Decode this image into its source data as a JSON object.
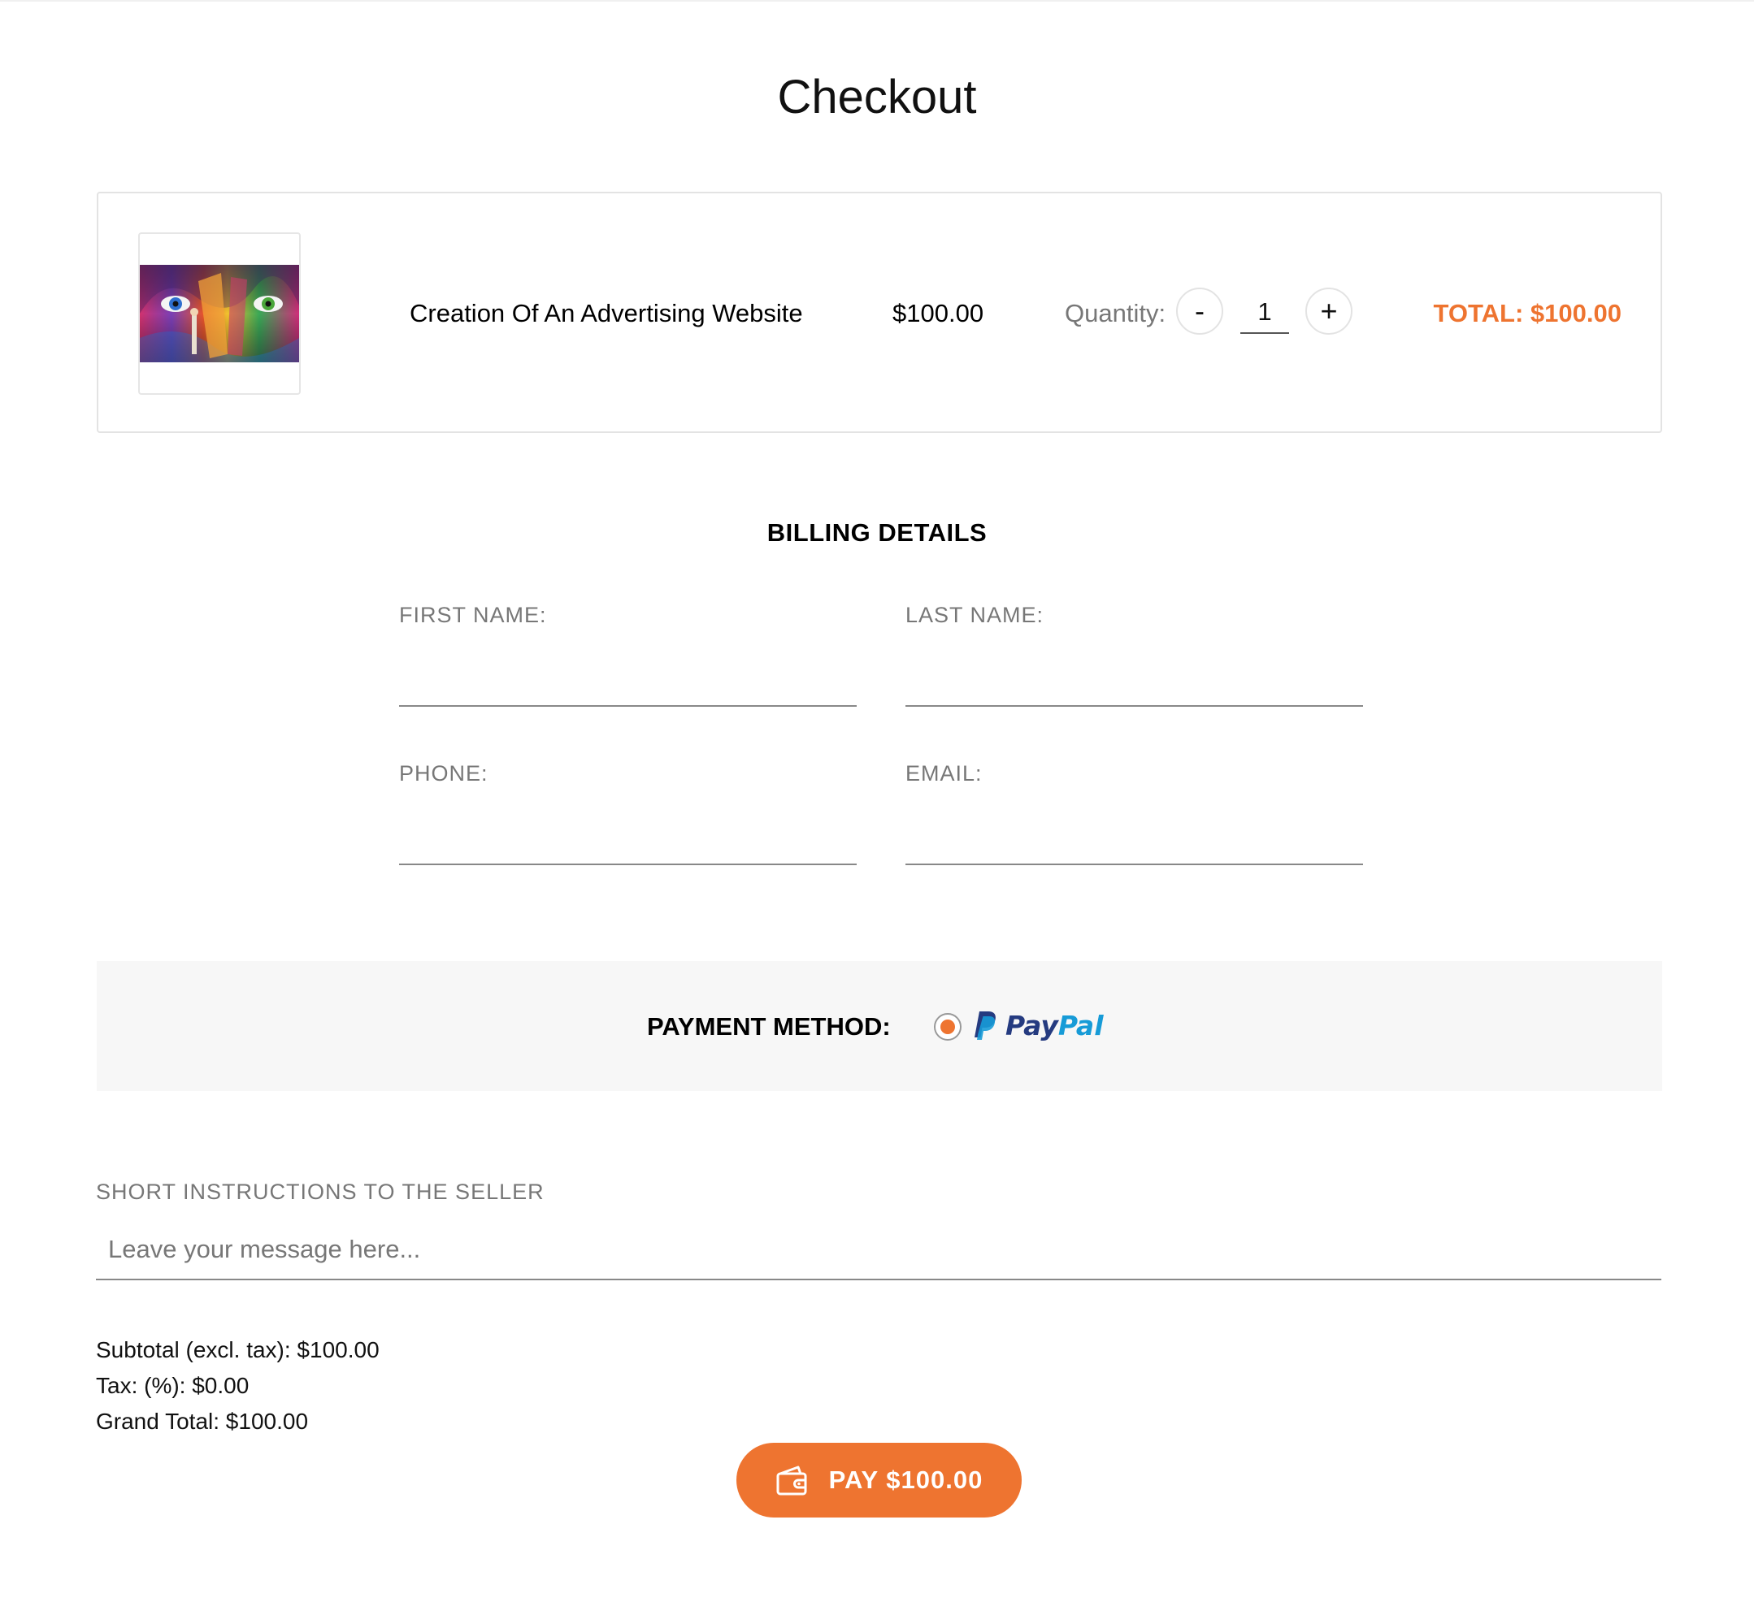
{
  "page": {
    "title": "Checkout"
  },
  "cart": {
    "product_name": "Creation Of An Advertising Website",
    "price": "$100.00",
    "quantity_label": "Quantity:",
    "decrement_label": "-",
    "increment_label": "+",
    "quantity_value": "1",
    "line_total": "TOTAL: $100.00",
    "thumbnail_icon": "colorful-face-painting-image"
  },
  "billing": {
    "heading": "BILLING DETAILS",
    "first_name_label": "FIRST NAME:",
    "first_name_value": "",
    "last_name_label": "LAST NAME:",
    "last_name_value": "",
    "phone_label": "PHONE:",
    "phone_value": "",
    "email_label": "EMAIL:",
    "email_value": ""
  },
  "payment": {
    "label": "PAYMENT METHOD:",
    "selected_method": "PayPal",
    "paypal_pay": "Pay",
    "paypal_pal": "Pal"
  },
  "instructions": {
    "label": "SHORT INSTRUCTIONS TO THE SELLER",
    "placeholder": "Leave your message here...",
    "value": ""
  },
  "summary": {
    "subtotal": "Subtotal (excl. tax): $100.00",
    "tax": "Tax: (%): $0.00",
    "grand_total": "Grand Total: $100.00"
  },
  "pay_button": {
    "label": "PAY $100.00",
    "icon": "wallet-icon"
  },
  "colors": {
    "accent": "#ee7430",
    "paypal_dark": "#253b80",
    "paypal_light": "#179bd7",
    "muted_text": "#777777",
    "payment_bg": "#f7f7f7"
  }
}
